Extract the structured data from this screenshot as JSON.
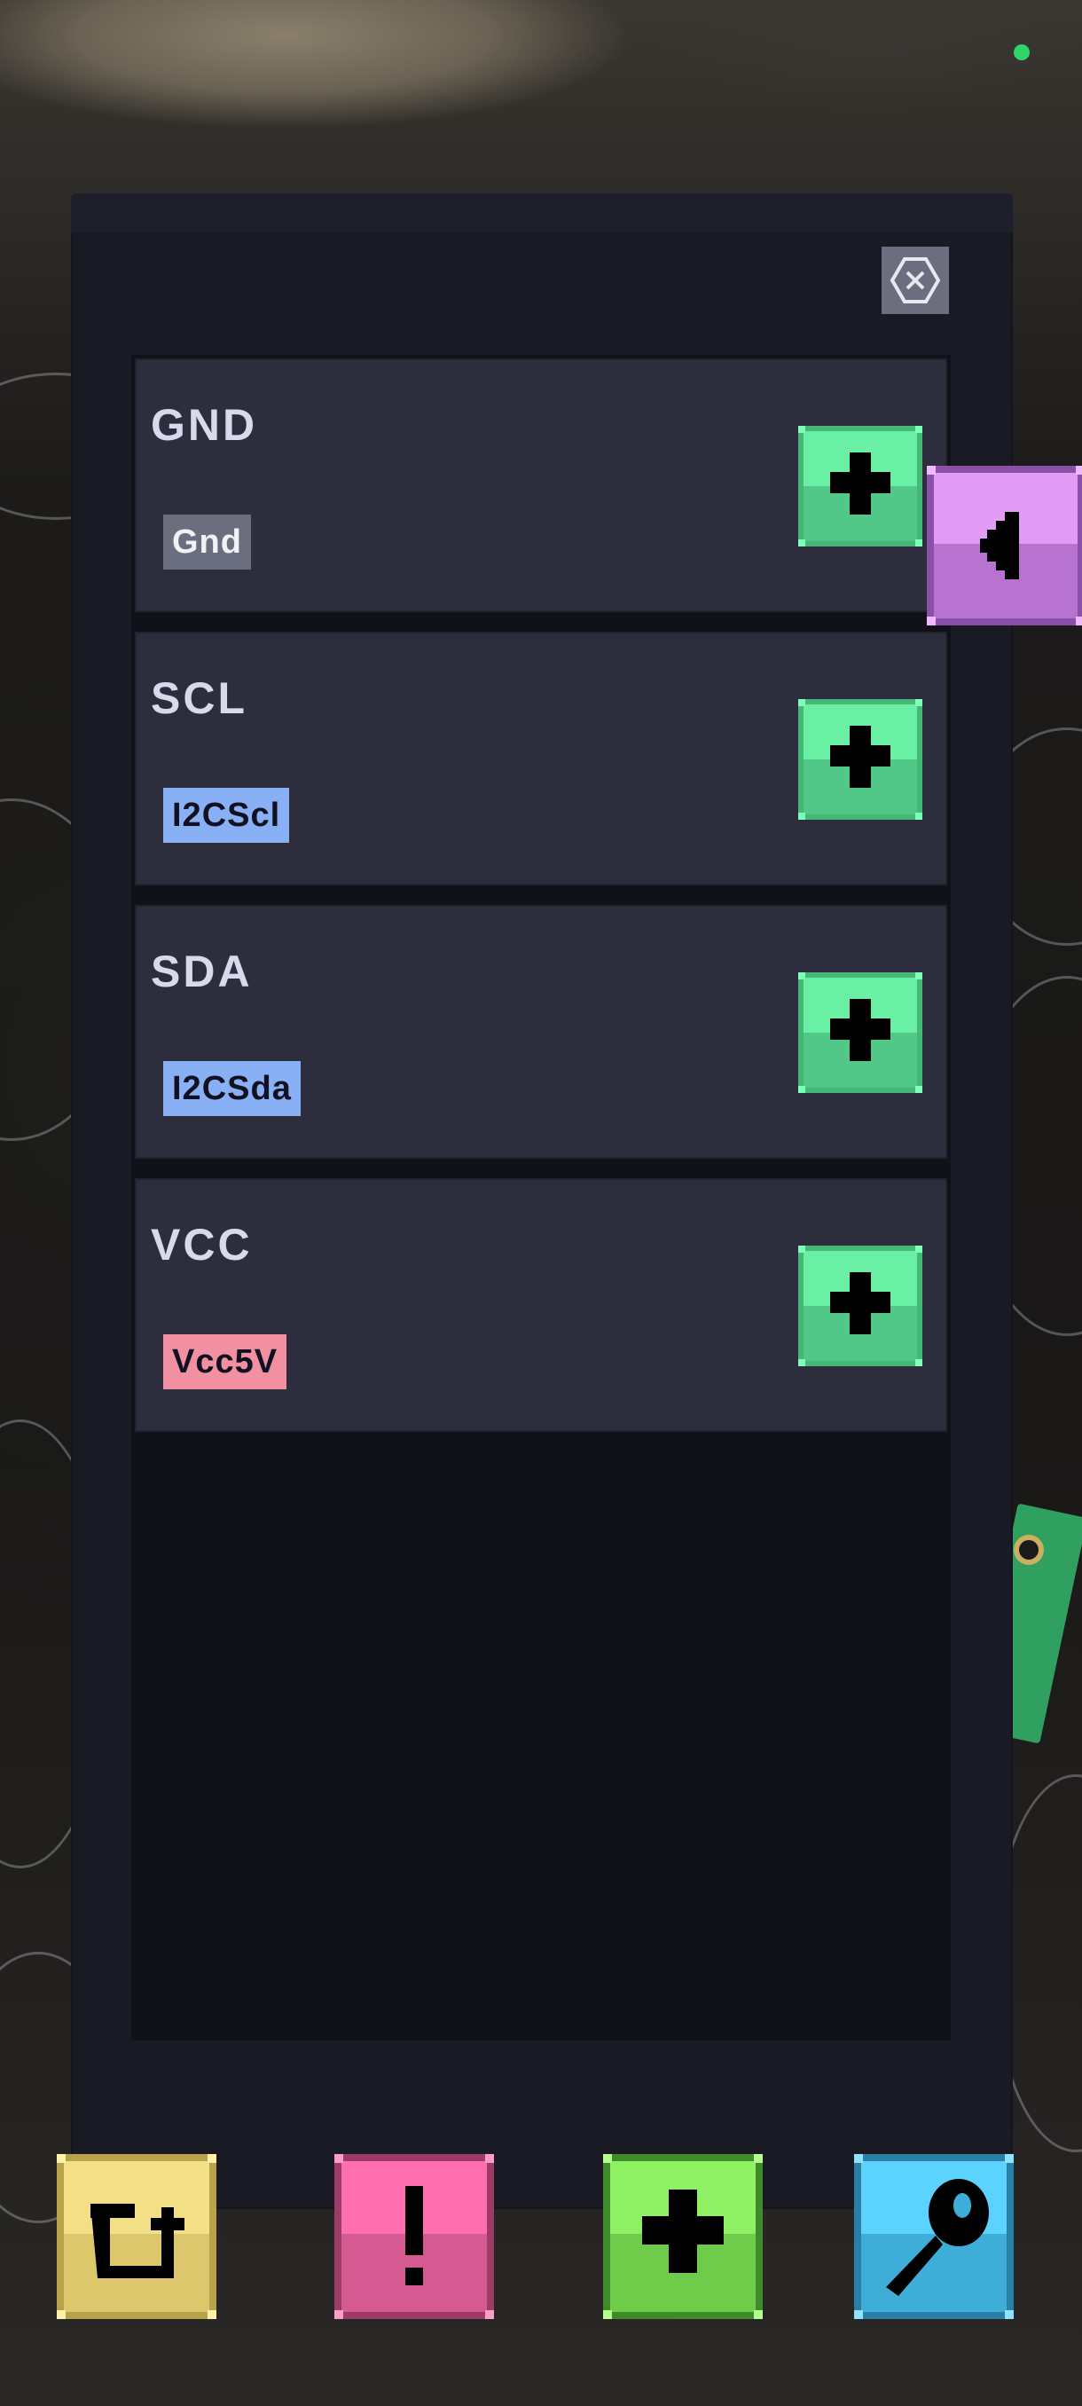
{
  "colors": {
    "panel_bg": "#1a1a25",
    "item_bg": "#2d2d3d",
    "tag_gnd": "#6b6e7e",
    "tag_i2c": "#89aff4",
    "tag_vcc": "#f090a0",
    "add_green": "#5ad88e",
    "side_purple": "#c783e8",
    "yellow": "#e9d47a",
    "pink": "#e0609a",
    "lime": "#6bd84a",
    "cyan": "#3eb6e6"
  },
  "pins": [
    {
      "name": "GND",
      "type": "Gnd",
      "add_icon": "plus-icon"
    },
    {
      "name": "SCL",
      "type": "I2CScl",
      "add_icon": "plus-icon"
    },
    {
      "name": "SDA",
      "type": "I2CSda",
      "add_icon": "plus-icon"
    },
    {
      "name": "VCC",
      "type": "Vcc5V",
      "add_icon": "plus-icon"
    }
  ],
  "icons": {
    "close": "close-icon",
    "side_tab": "collapse-left-icon",
    "bottom": [
      "return-icon",
      "alert-icon",
      "add-icon",
      "probe-icon"
    ]
  }
}
